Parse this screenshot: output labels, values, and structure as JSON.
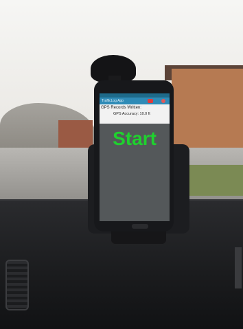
{
  "phone_screen": {
    "app_title": "TrafficLog App",
    "gps_records": "GPS Records Written:",
    "gps_accuracy": "GPS Accuracy: 10.0 ft",
    "start_label": "Start"
  },
  "colors": {
    "app_bar": "#2f8bb7",
    "start_text": "#1fd12e"
  }
}
